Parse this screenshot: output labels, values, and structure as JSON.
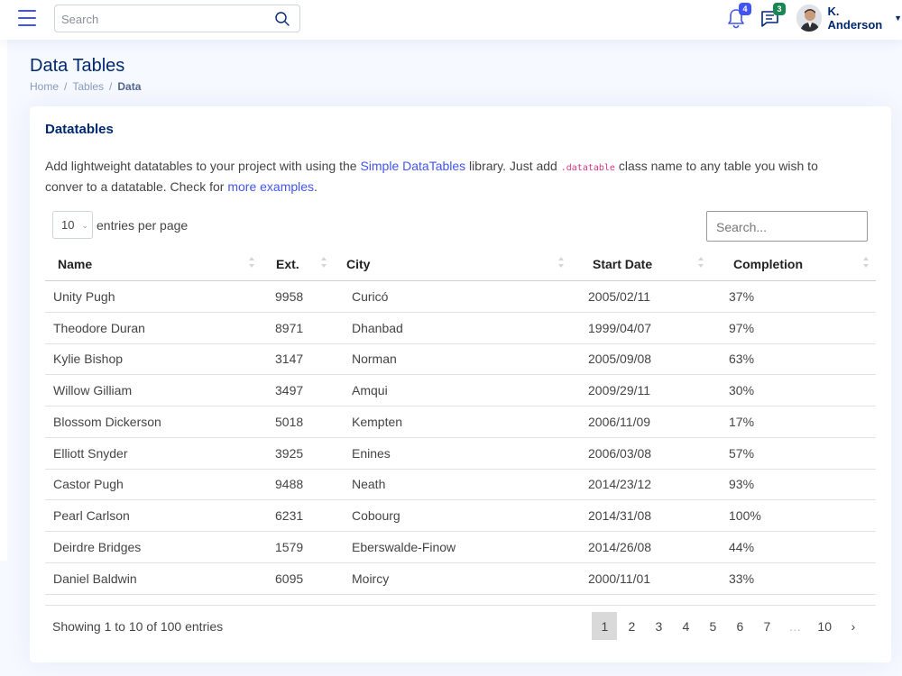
{
  "header": {
    "search_placeholder": "Search",
    "notifications_count": "4",
    "messages_count": "3",
    "profile_name": "K. Anderson"
  },
  "page": {
    "title": "Data Tables",
    "breadcrumb": [
      "Home",
      "Tables",
      "Data"
    ]
  },
  "card": {
    "title": "Datatables",
    "desc_1": "Add lightweight datatables to your project with using the ",
    "desc_link_1": "Simple DataTables",
    "desc_2": " library. Just add ",
    "desc_code": ".datatable",
    "desc_3": " class name to any table you wish to conver to a datatable. Check for ",
    "desc_link_2": "more examples",
    "desc_4": "."
  },
  "table_controls": {
    "per_page_value": "10",
    "per_page_label": "entries per page",
    "search_placeholder": "Search..."
  },
  "table": {
    "columns": [
      "Name",
      "Ext.",
      "City",
      "Start Date",
      "Completion"
    ],
    "rows": [
      [
        "Unity Pugh",
        "9958",
        "Curicó",
        "2005/02/11",
        "37%"
      ],
      [
        "Theodore Duran",
        "8971",
        "Dhanbad",
        "1999/04/07",
        "97%"
      ],
      [
        "Kylie Bishop",
        "3147",
        "Norman",
        "2005/09/08",
        "63%"
      ],
      [
        "Willow Gilliam",
        "3497",
        "Amqui",
        "2009/29/11",
        "30%"
      ],
      [
        "Blossom Dickerson",
        "5018",
        "Kempten",
        "2006/11/09",
        "17%"
      ],
      [
        "Elliott Snyder",
        "3925",
        "Enines",
        "2006/03/08",
        "57%"
      ],
      [
        "Castor Pugh",
        "9488",
        "Neath",
        "2014/23/12",
        "93%"
      ],
      [
        "Pearl Carlson",
        "6231",
        "Cobourg",
        "2014/31/08",
        "100%"
      ],
      [
        "Deirdre Bridges",
        "1579",
        "Eberswalde-Finow",
        "2014/26/08",
        "44%"
      ],
      [
        "Daniel Baldwin",
        "6095",
        "Moircy",
        "2000/11/01",
        "33%"
      ]
    ]
  },
  "footer": {
    "showing": "Showing 1 to 10 of 100 entries",
    "pages": [
      "1",
      "2",
      "3",
      "4",
      "5",
      "6",
      "7",
      "…",
      "10",
      "›"
    ],
    "active_page": "1"
  },
  "colors": {
    "accent": "#4154f1",
    "title": "#012970",
    "badge_green": "#198754"
  }
}
